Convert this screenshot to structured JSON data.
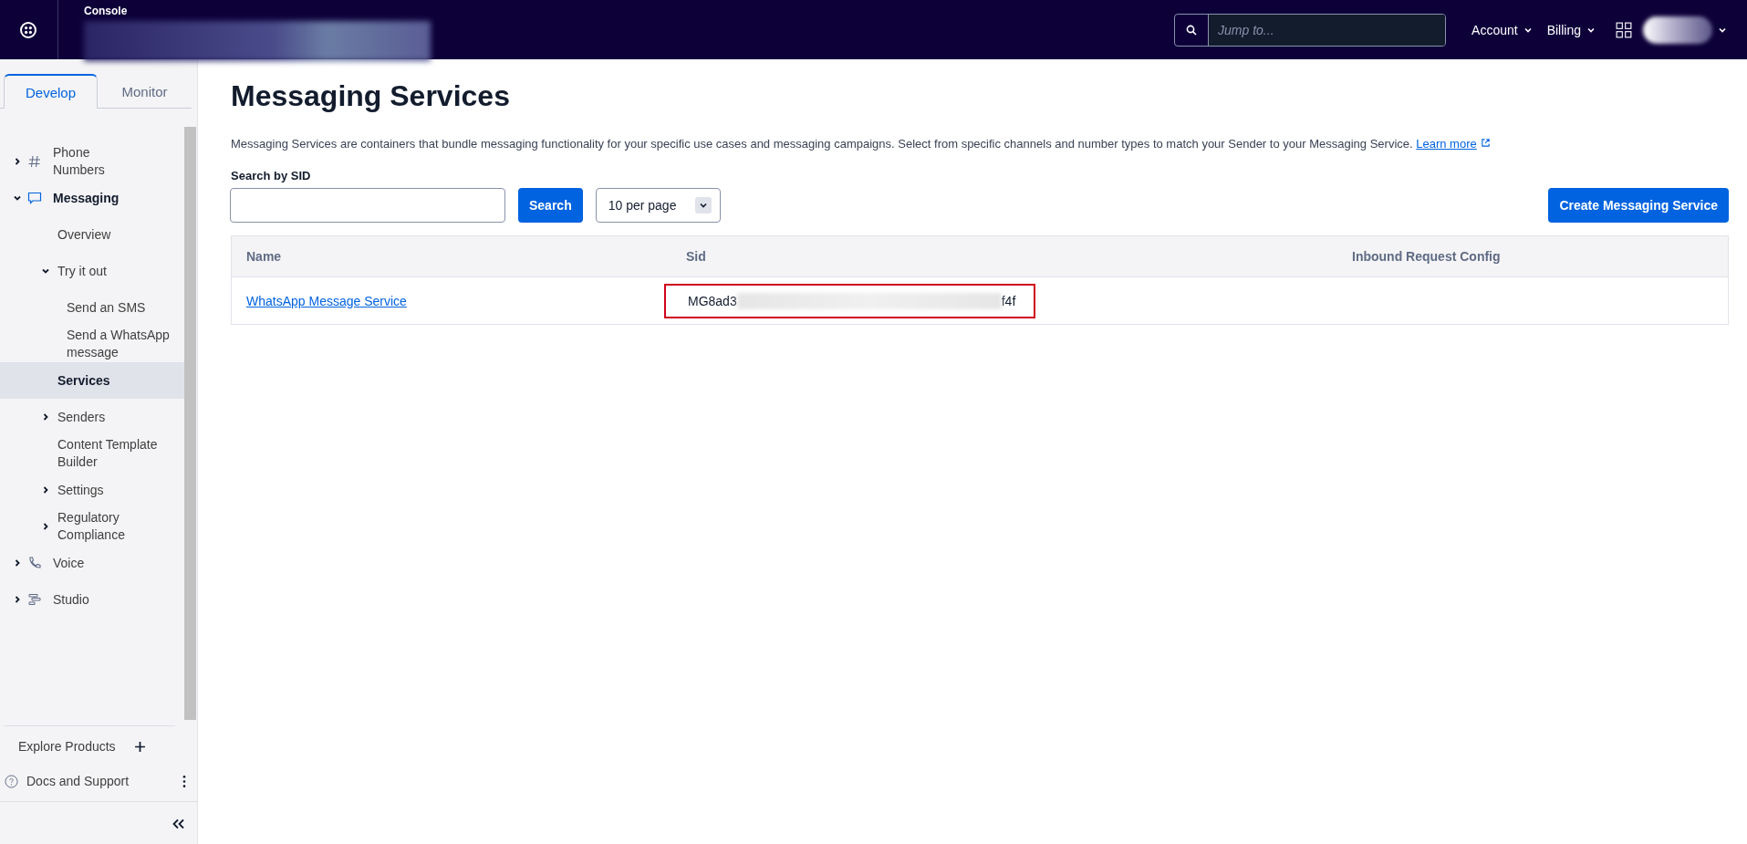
{
  "header": {
    "product": "Console",
    "search": {
      "placeholder": "Jump to..."
    },
    "menus": [
      {
        "label": "Account"
      },
      {
        "label": "Billing"
      }
    ]
  },
  "sidebar": {
    "tabs": [
      {
        "label": "Develop",
        "selected": true
      },
      {
        "label": "Monitor",
        "selected": false
      }
    ],
    "nav": [
      {
        "label": "Phone Numbers",
        "expanded": false,
        "selected": false
      },
      {
        "label": "Messaging",
        "expanded": true,
        "selected": false,
        "children": [
          {
            "label": "Overview",
            "selected": false
          },
          {
            "label": "Try it out",
            "expanded": true,
            "selected": false,
            "children": [
              {
                "label": "Send an SMS",
                "selected": false
              },
              {
                "label": "Send a WhatsApp message",
                "selected": false
              }
            ]
          },
          {
            "label": "Services",
            "selected": true
          },
          {
            "label": "Senders",
            "expanded": false,
            "selected": false
          },
          {
            "label": "Content Template Builder",
            "selected": false
          },
          {
            "label": "Settings",
            "expanded": false,
            "selected": false
          },
          {
            "label": "Regulatory Compliance",
            "expanded": false,
            "selected": false
          }
        ]
      },
      {
        "label": "Voice",
        "expanded": false,
        "selected": false
      },
      {
        "label": "Studio",
        "expanded": false,
        "selected": false
      }
    ],
    "explore": "Explore Products",
    "docs": "Docs and Support"
  },
  "page": {
    "title": "Messaging Services",
    "description": "Messaging Services are containers that bundle messaging functionality for your specific use cases and messaging campaigns. Select from specific channels and number types to match your Sender to your Messaging Service.",
    "learn_more": "Learn more",
    "search_label": "Search by SID",
    "search_button": "Search",
    "page_size": "10 per page",
    "create_button": "Create Messaging Service",
    "table": {
      "columns": [
        "Name",
        "Sid",
        "Inbound Request Config"
      ],
      "rows": [
        {
          "name": "WhatsApp Message Service",
          "sid_start": "MG8ad3",
          "sid_end": "f4f",
          "highlighted": true
        }
      ]
    }
  }
}
